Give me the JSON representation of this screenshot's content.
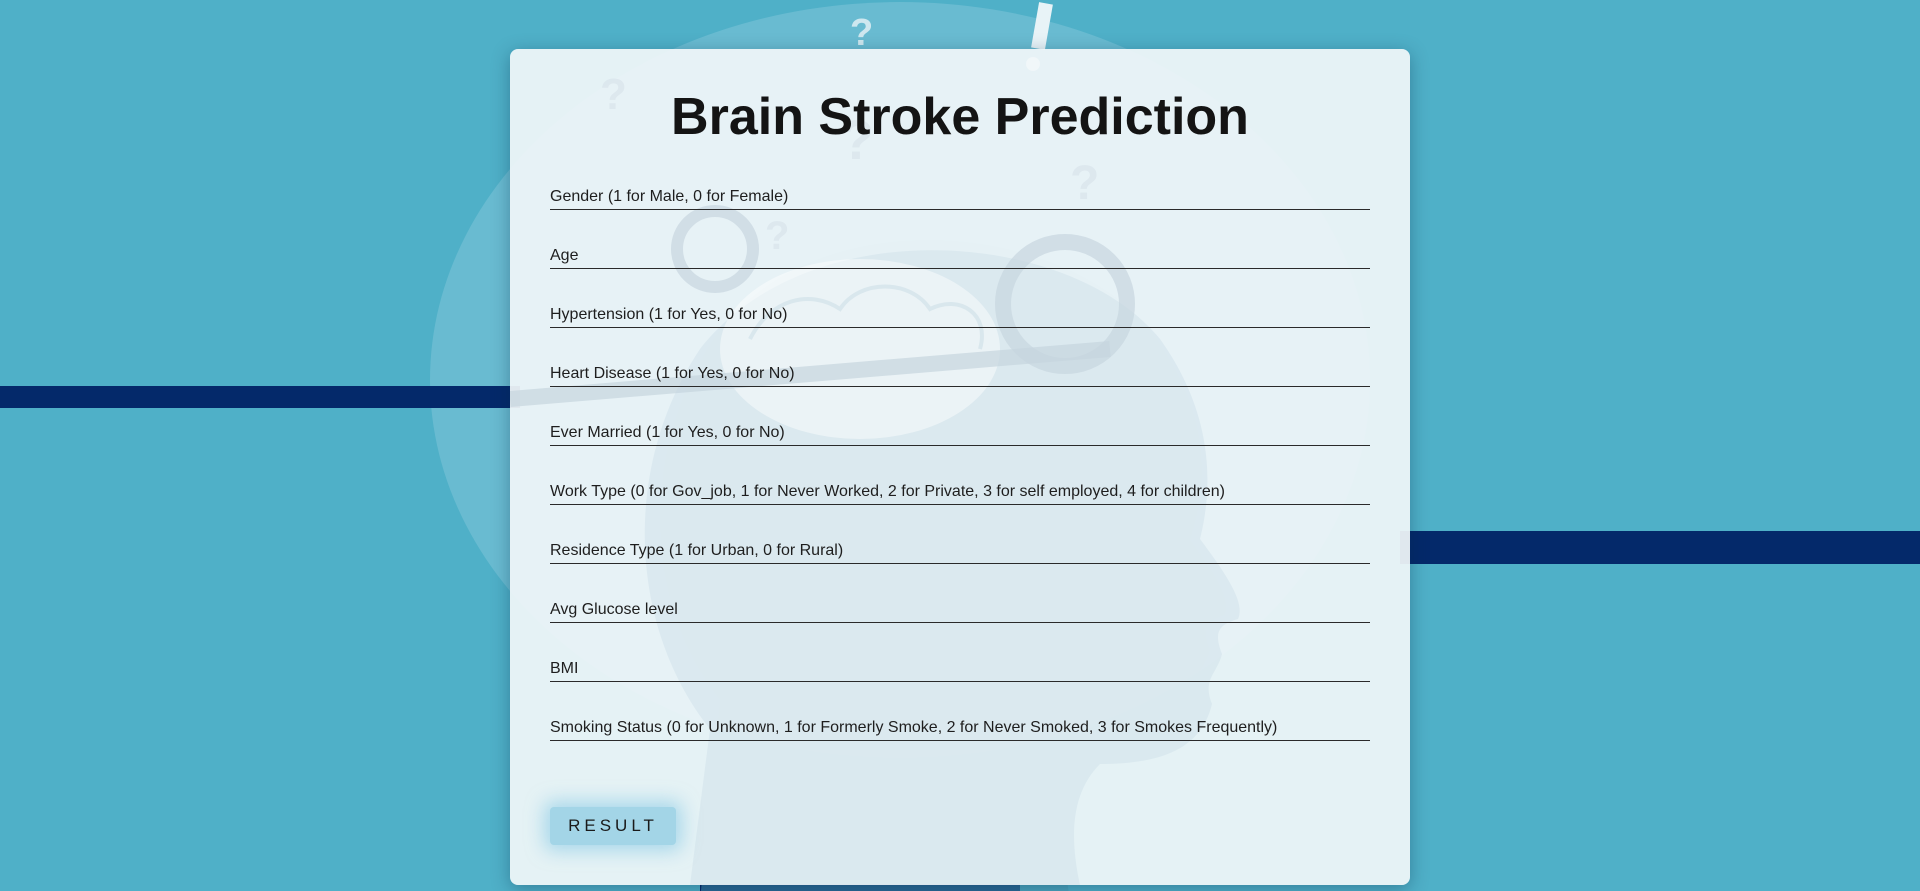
{
  "page": {
    "title": "Brain Stroke Prediction"
  },
  "form": {
    "fields": [
      {
        "placeholder": "Gender (1 for Male, 0 for Female)"
      },
      {
        "placeholder": "Age"
      },
      {
        "placeholder": "Hypertension (1 for Yes, 0 for No)"
      },
      {
        "placeholder": "Heart Disease (1 for Yes, 0 for No)"
      },
      {
        "placeholder": "Ever Married (1 for Yes, 0 for No)"
      },
      {
        "placeholder": "Work Type (0 for Gov_job, 1 for Never Worked, 2 for Private, 3 for self employed, 4 for children)"
      },
      {
        "placeholder": "Residence Type (1 for Urban, 0 for Rural)"
      },
      {
        "placeholder": "Avg Glucose level"
      },
      {
        "placeholder": "BMI"
      },
      {
        "placeholder": "Smoking Status (0 for Unknown, 1 for Formerly Smoke, 2 for Never Smoked, 3 for Smokes Frequently)"
      }
    ],
    "submit_label": "RESULT"
  },
  "colors": {
    "background": "#4fb0c8",
    "stripe": "#04296a",
    "button": "#a3d5e7"
  }
}
